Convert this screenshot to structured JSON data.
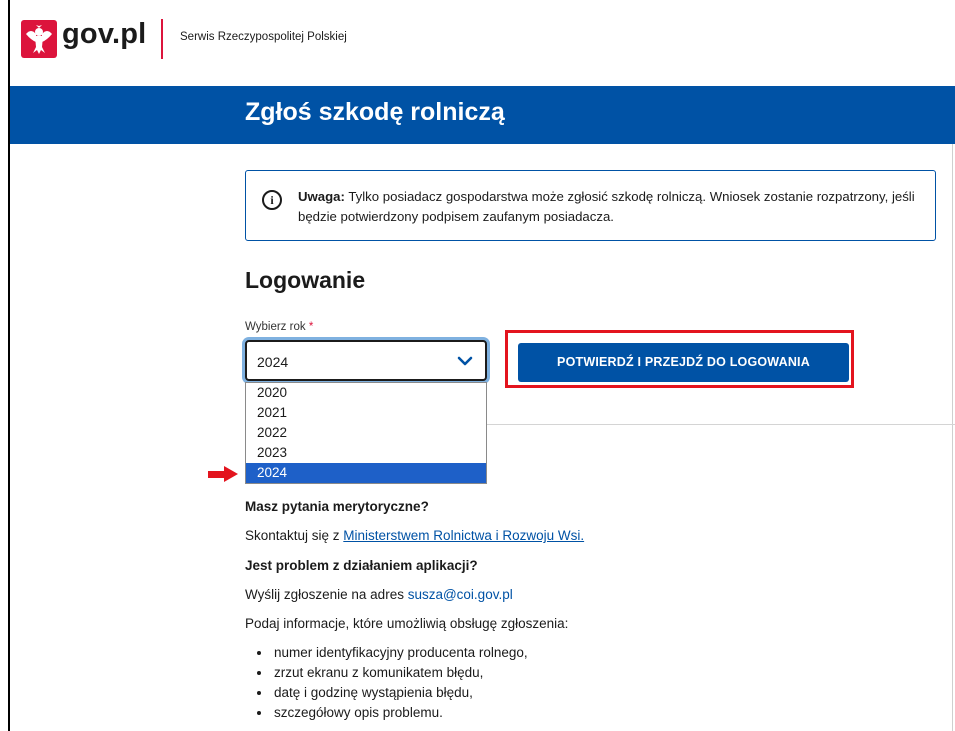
{
  "header": {
    "logo_text": "gov.pl",
    "service_name": "Serwis Rzeczypospolitej Polskiej"
  },
  "hero": {
    "title": "Zgłoś szkodę rolniczą"
  },
  "alert": {
    "icon": "info-icon",
    "bold": "Uwaga:",
    "text": " Tylko posiadacz gospodarstwa może zgłosić szkodę rolniczą. Wniosek zostanie rozpatrzony, jeśli będzie potwierdzony podpisem zaufanym posiadacza."
  },
  "login": {
    "title": "Logowanie",
    "year_label": "Wybierz rok",
    "required_mark": "*",
    "selected_year": "2024",
    "year_options": [
      "2020",
      "2021",
      "2022",
      "2023",
      "2024"
    ],
    "submit_label": "POTWIERDŹ I PRZEJDŹ DO LOGOWANIA"
  },
  "help": {
    "partially_hidden_line": "...",
    "q1": "Masz pytania merytoryczne?",
    "p1_prefix": "Skontaktuj się z ",
    "p1_link": "Ministerstwem Rolnictwa i Rozwoju Wsi.",
    "q2": "Jest problem z działaniem aplikacji?",
    "p2_prefix": "Wyślij zgłoszenie na adres ",
    "p2_email": "susza@coi.gov.pl",
    "p3": "Podaj informacje, które umożliwią obsługę zgłoszenia:",
    "bullets": [
      "numer identyfikacyjny producenta rolnego,",
      "zrzut ekranu z komunikatem błędu,",
      "datę i godzinę wystąpienia błędu,",
      "szczegółowy opis problemu."
    ]
  },
  "colors": {
    "brand_blue": "#0052a5",
    "gov_red": "#dc143c",
    "annotation_red": "#e3141e",
    "selected_option": "#1e60c8"
  }
}
